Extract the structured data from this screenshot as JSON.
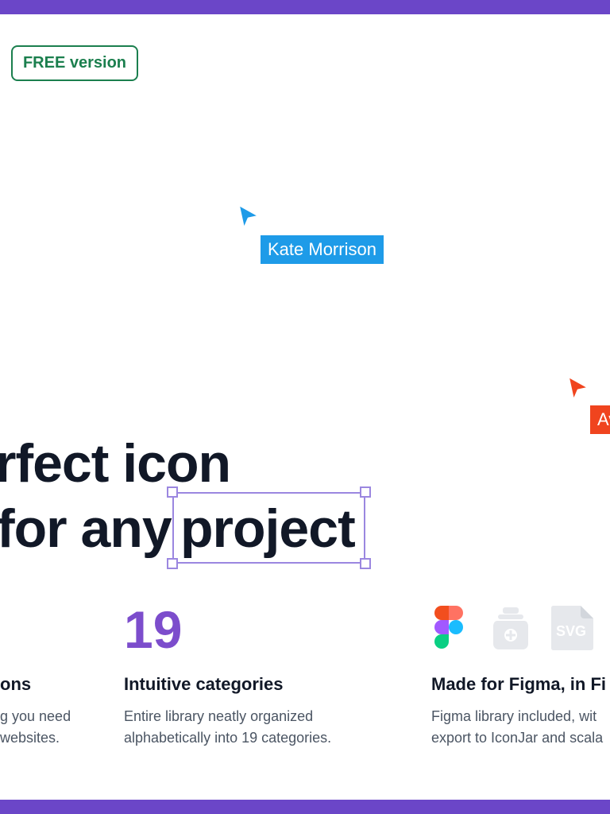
{
  "badge": {
    "label": "FREE version"
  },
  "cursors": [
    {
      "name": "Kate Morrison",
      "color": "#1e9be8"
    },
    {
      "name": "Av",
      "color": "#f0441e"
    }
  ],
  "hero": {
    "line1": "rfect icon",
    "line2_prefix": "for any",
    "line2_highlight": "project"
  },
  "features": [
    {
      "title": "ons",
      "description": "g you need\nwebsites."
    },
    {
      "stat": "19",
      "title": "Intuitive categories",
      "description": "Entire library neatly organized\nalphabetically into 19 categories."
    },
    {
      "title": "Made for Figma, in Fi",
      "description": "Figma library included, wit\nexport to IconJar and scala"
    }
  ],
  "format_icons": [
    "figma-icon",
    "iconjar-icon",
    "svg-file-icon"
  ],
  "svg_label": "SVG",
  "colors": {
    "accent_purple": "#6b46c8",
    "stat_purple": "#7c4dcc",
    "badge_green": "#1b7f4e"
  }
}
